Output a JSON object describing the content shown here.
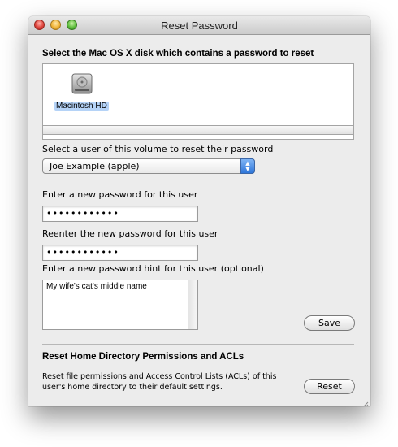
{
  "window": {
    "title": "Reset Password"
  },
  "disk_section": {
    "heading": "Select the Mac OS X disk which contains a password to reset",
    "disks": [
      {
        "label": "Macintosh HD",
        "icon": "hard-drive-icon",
        "selected": true
      }
    ]
  },
  "user_section": {
    "label": "Select a user of this volume to reset their password",
    "selected_user": "Joe Example (apple)"
  },
  "password": {
    "new_label": "Enter a new password for this user",
    "new_value": "••••••••••••",
    "reenter_label": "Reenter the new password for this user",
    "reenter_value": "••••••••••••",
    "hint_label": "Enter a new password hint for this user (optional)",
    "hint_value": "My wife's cat's middle name",
    "save_label": "Save"
  },
  "acl_section": {
    "heading": "Reset Home Directory Permissions and ACLs",
    "description": "Reset file permissions and Access Control Lists (ACLs) of this user's home directory to their default settings.",
    "reset_label": "Reset"
  },
  "colors": {
    "selection_highlight": "#b5d3f7",
    "popup_arrow_blue": "#3b7fe0"
  }
}
